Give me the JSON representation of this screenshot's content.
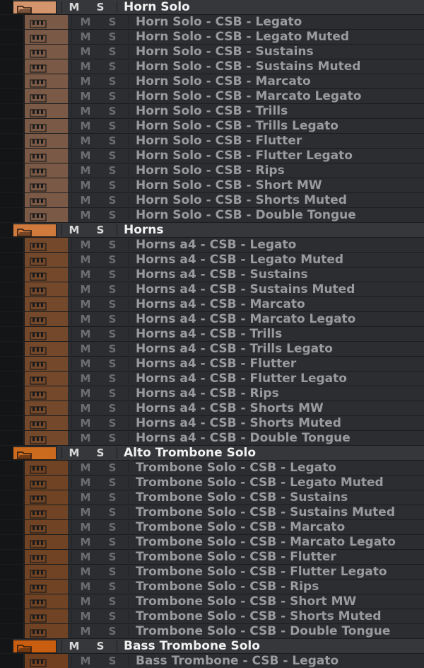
{
  "buttons": {
    "mute_label": "M",
    "solo_label": "S"
  },
  "colors": {
    "horn_solo": "#d4956c",
    "horns": "#d07a3e",
    "alto_trombone": "#cc6a1e",
    "bass_trombone": "#c95e10",
    "horn_solo_track": "#7a5a46",
    "horns_track": "#73482b",
    "alto_trombone_track": "#6f4324",
    "bass_trombone_track": "#6f3f1f"
  },
  "folders": [
    {
      "name": "Horn Solo",
      "color": "#d4956c",
      "track_color": "#7a5a46",
      "icon": "folder-icon",
      "tracks": [
        "Horn Solo - CSB - Legato",
        "Horn Solo - CSB - Legato Muted",
        "Horn Solo - CSB - Sustains",
        "Horn Solo - CSB - Sustains Muted",
        "Horn Solo - CSB - Marcato",
        "Horn Solo - CSB - Marcato Legato",
        "Horn Solo - CSB - Trills",
        "Horn Solo - CSB - Trills Legato",
        "Horn Solo - CSB - Flutter",
        "Horn Solo - CSB - Flutter Legato",
        "Horn Solo - CSB - Rips",
        "Horn Solo - CSB - Short MW",
        "Horn Solo - CSB - Shorts Muted",
        "Horn Solo - CSB - Double Tongue"
      ]
    },
    {
      "name": "Horns",
      "color": "#d07a3e",
      "track_color": "#73482b",
      "icon": "folder-icon",
      "tracks": [
        "Horns a4 - CSB - Legato",
        "Horns a4 - CSB - Legato Muted",
        "Horns a4 - CSB - Sustains",
        "Horns a4 - CSB - Sustains Muted",
        "Horns a4 - CSB - Marcato",
        "Horns a4 - CSB - Marcato Legato",
        "Horns a4 - CSB - Trills",
        "Horns a4 - CSB - Trills Legato",
        "Horns a4 - CSB - Flutter",
        "Horns a4 - CSB - Flutter Legato",
        "Horns a4 - CSB - Rips",
        "Horns a4 - CSB - Shorts MW",
        "Horns a4 - CSB - Shorts Muted",
        "Horns a4 - CSB - Double Tongue"
      ]
    },
    {
      "name": "Alto Trombone Solo",
      "color": "#cc6a1e",
      "track_color": "#6f4324",
      "icon": "folder-icon",
      "tracks": [
        "Trombone Solo - CSB - Legato",
        "Trombone Solo - CSB - Legato Muted",
        "Trombone Solo - CSB - Sustains",
        "Trombone Solo - CSB - Sustains Muted",
        "Trombone Solo - CSB - Marcato",
        "Trombone Solo - CSB - Marcato Legato",
        "Trombone Solo - CSB - Flutter",
        "Trombone Solo - CSB - Flutter Legato",
        "Trombone Solo - CSB - Rips",
        "Trombone Solo - CSB - Short MW",
        "Trombone Solo - CSB - Shorts Muted",
        "Trombone Solo - CSB - Double Tongue"
      ]
    },
    {
      "name": "Bass Trombone Solo",
      "color": "#c95e10",
      "track_color": "#6f3f1f",
      "icon": "folder-icon",
      "tracks": [
        "Bass Trombone - CSB - Legato"
      ]
    }
  ]
}
